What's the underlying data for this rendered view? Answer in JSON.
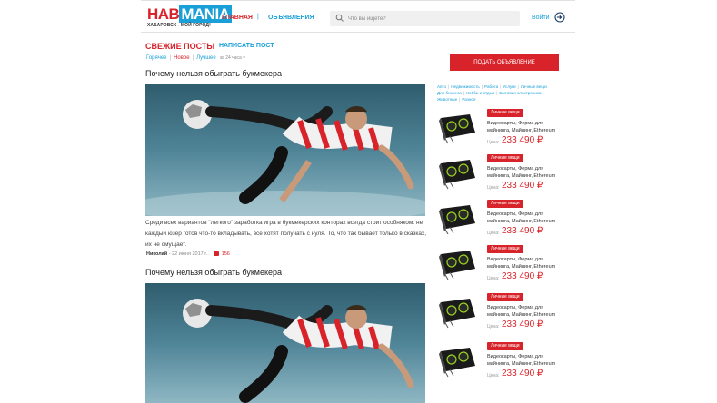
{
  "header": {
    "logo_hab": "HAB",
    "logo_mania": "MANIA",
    "logo_sub": "ХАБАРОВСК - МОЙ ГОРОД!",
    "nav_main": "ГЛАВНАЯ",
    "nav_sep": "|",
    "nav_ads": "ОБЪЯВЛЕНИЯ",
    "search_placeholder": "Что вы ищете?",
    "login": "Войти"
  },
  "feed": {
    "section_title": "СВЕЖИЕ ПОСТЫ",
    "write_post": "НАПИСАТЬ ПОСТ",
    "filters": {
      "hot": "Горячее",
      "new": "Новое",
      "best": "Лучшее",
      "period": "за 24 часа ▾"
    },
    "posts": [
      {
        "title": "Почему нельзя обыграть букмекера",
        "excerpt": "Среди всех вариантов \"легкого\" заработка игра в букмекерских конторах всегда стоит особняком: не каждый юзер готов что-то вкладывать, все хотят получать с нуля. То, что так бывает только в сказках, их не смущает.",
        "author": "Николай",
        "date": "- 22 июня 2017 г.",
        "comments": "156"
      },
      {
        "title": "Почему нельзя обыграть букмекера"
      }
    ]
  },
  "sidebar": {
    "ad_button": "ПОДАТЬ ОБЪЯВЛЕНИЕ",
    "categories": [
      "Авто",
      "Недвижимость",
      "Работа",
      "Услуги",
      "Личные вещи",
      "Для бизнеса",
      "Хобби и отдых",
      "Бытовая электроника",
      "Животные",
      "Разное"
    ],
    "listings": [
      {
        "badge": "Личные вещи",
        "desc": "Видеокарты, Ферма для майнинга, Майнинг, Ethereum",
        "price_label": "Цена:",
        "price": "233 490 ₽"
      },
      {
        "badge": "Личные вещи",
        "desc": "Видеокарты, Ферма для майнинга, Майнинг, Ethereum",
        "price_label": "Цена:",
        "price": "233 490 ₽"
      },
      {
        "badge": "Личные вещи",
        "desc": "Видеокарты, Ферма для майнинга, Майнинг, Ethereum",
        "price_label": "Цена:",
        "price": "233 490 ₽"
      },
      {
        "badge": "Личные вещи",
        "desc": "Видеокарты, Ферма для майнинга, Майнинг, Ethereum",
        "price_label": "Цена:",
        "price": "233 490 ₽"
      },
      {
        "badge": "Личные вещи",
        "desc": "Видеокарты, Ферма для майнинга, Майнинг, Ethereum",
        "price_label": "Цена:",
        "price": "233 490 ₽"
      },
      {
        "badge": "Личные вещи",
        "desc": "Видеокарты, Ферма для майнинга, Майнинг, Ethereum",
        "price_label": "Цена:",
        "price": "233 490 ₽"
      }
    ]
  },
  "colors": {
    "brand_red": "#d8232a",
    "brand_blue": "#1aa0d8"
  }
}
